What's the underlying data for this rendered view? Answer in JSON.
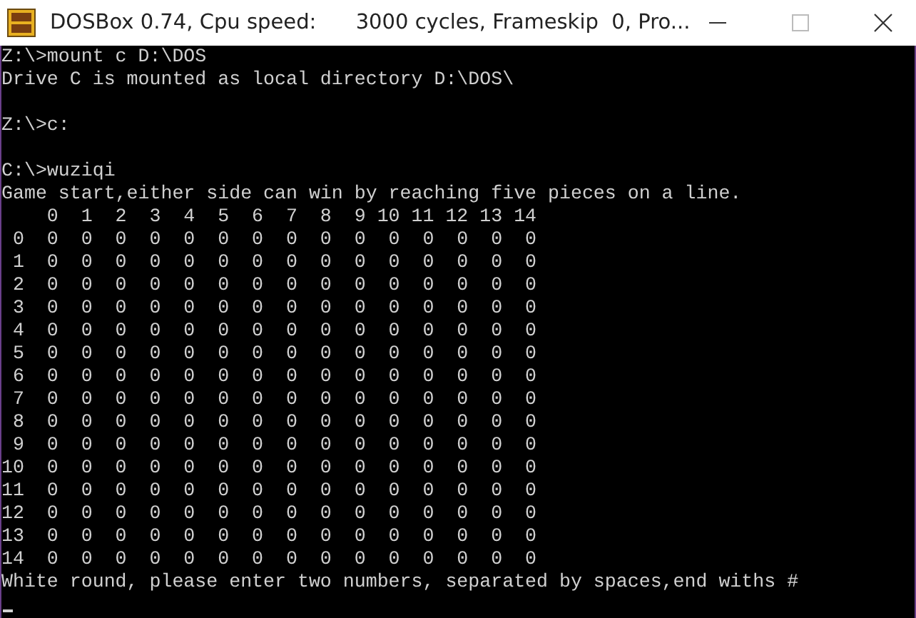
{
  "window": {
    "title": "DOSBox 0.74, Cpu speed:      3000 cycles, Frameskip  0, Pro..."
  },
  "console": {
    "lines": [
      {
        "kind": "text",
        "text": "Z:\\>mount c D:\\DOS"
      },
      {
        "kind": "text",
        "text": "Drive C is mounted as local directory D:\\DOS\\"
      },
      {
        "kind": "blank"
      },
      {
        "kind": "text",
        "text": "Z:\\>c:"
      },
      {
        "kind": "blank"
      },
      {
        "kind": "text",
        "text": "C:\\>wuziqi"
      },
      {
        "kind": "text",
        "text": "Game start,either side can win by reaching five pieces on a line."
      },
      {
        "kind": "text",
        "text": "    0  1  2  3  4  5  6  7  8  9 10 11 12 13 14"
      },
      {
        "kind": "text",
        "text": " 0  0  0  0  0  0  0  0  0  0  0  0  0  0  0  0"
      },
      {
        "kind": "text",
        "text": " 1  0  0  0  0  0  0  0  0  0  0  0  0  0  0  0"
      },
      {
        "kind": "text",
        "text": " 2  0  0  0  0  0  0  0  0  0  0  0  0  0  0  0"
      },
      {
        "kind": "text",
        "text": " 3  0  0  0  0  0  0  0  0  0  0  0  0  0  0  0"
      },
      {
        "kind": "text",
        "text": " 4  0  0  0  0  0  0  0  0  0  0  0  0  0  0  0"
      },
      {
        "kind": "text",
        "text": " 5  0  0  0  0  0  0  0  0  0  0  0  0  0  0  0"
      },
      {
        "kind": "text",
        "text": " 6  0  0  0  0  0  0  0  0  0  0  0  0  0  0  0"
      },
      {
        "kind": "text",
        "text": " 7  0  0  0  0  0  0  0  0  0  0  0  0  0  0  0"
      },
      {
        "kind": "text",
        "text": " 8  0  0  0  0  0  0  0  0  0  0  0  0  0  0  0"
      },
      {
        "kind": "text",
        "text": " 9  0  0  0  0  0  0  0  0  0  0  0  0  0  0  0"
      },
      {
        "kind": "text",
        "text": "10  0  0  0  0  0  0  0  0  0  0  0  0  0  0  0"
      },
      {
        "kind": "text",
        "text": "11  0  0  0  0  0  0  0  0  0  0  0  0  0  0  0"
      },
      {
        "kind": "text",
        "text": "12  0  0  0  0  0  0  0  0  0  0  0  0  0  0  0"
      },
      {
        "kind": "text",
        "text": "13  0  0  0  0  0  0  0  0  0  0  0  0  0  0  0"
      },
      {
        "kind": "text",
        "text": "14  0  0  0  0  0  0  0  0  0  0  0  0  0  0  0"
      },
      {
        "kind": "text",
        "text": "White round, please enter two numbers, separated by spaces,end withs #"
      },
      {
        "kind": "cursor"
      }
    ]
  }
}
